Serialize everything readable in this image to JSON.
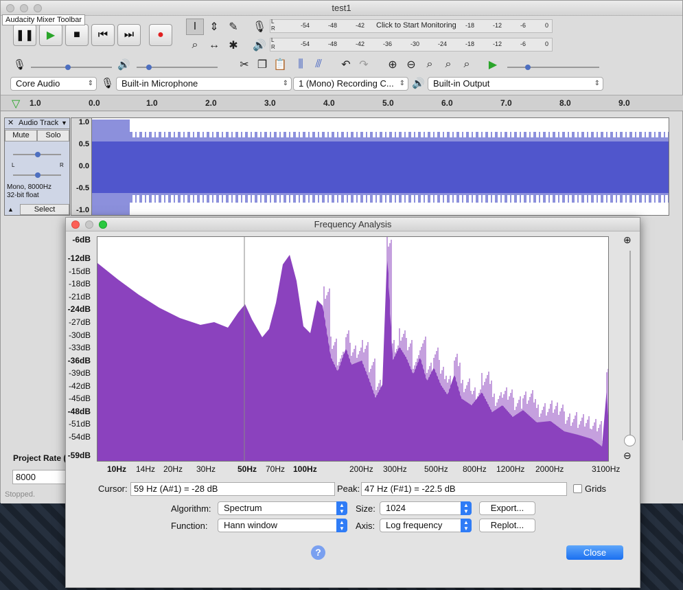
{
  "window": {
    "title": "test1"
  },
  "tooltip": "Audacity Mixer Toolbar",
  "meter": {
    "record_ticks": [
      "L",
      "R",
      "-54",
      "-48",
      "-42",
      "Click to Start Monitoring",
      "-18",
      "-12",
      "-6",
      "0"
    ],
    "play_ticks": [
      "L",
      "R",
      "-54",
      "-48",
      "-42",
      "-36",
      "-30",
      "-24",
      "-18",
      "-12",
      "-6",
      "0"
    ]
  },
  "devices": {
    "host": "Core Audio",
    "recording": "Built-in Microphone",
    "channels": "1 (Mono) Recording C...",
    "playback": "Built-in Output"
  },
  "ruler": {
    "labels": [
      "1.0",
      "0.0",
      "1.0",
      "2.0",
      "3.0",
      "4.0",
      "5.0",
      "6.0",
      "7.0",
      "8.0",
      "9.0"
    ]
  },
  "track": {
    "name": "Audio Track",
    "mute": "Mute",
    "solo": "Solo",
    "left": "L",
    "right": "R",
    "info1": "Mono, 8000Hz",
    "info2": "32-bit float",
    "select": "Select",
    "yticks": [
      "1.0",
      "0.5",
      "0.0",
      "-0.5",
      "-1.0"
    ]
  },
  "selection_bar": {
    "project_rate_label": "Project Rate (H",
    "project_rate": "8000",
    "status": "Stopped."
  },
  "freq": {
    "title": "Frequency Analysis",
    "db_labels": [
      "-6dB",
      "-12dB",
      "-15dB",
      "-18dB",
      "-21dB",
      "-24dB",
      "-27dB",
      "-30dB",
      "-33dB",
      "-36dB",
      "-39dB",
      "-42dB",
      "-45dB",
      "-48dB",
      "-51dB",
      "-54dB",
      "-59dB"
    ],
    "hz_labels": [
      "10Hz",
      "14Hz",
      "20Hz",
      "30Hz",
      "50Hz",
      "70Hz",
      "100Hz",
      "200Hz",
      "300Hz",
      "500Hz",
      "800Hz",
      "1200Hz",
      "2000Hz",
      "3100Hz"
    ],
    "cursor_label": "Cursor:",
    "cursor_value": "59 Hz (A#1) = -28 dB",
    "peak_label": "Peak:",
    "peak_value": "47 Hz (F#1) = -22.5 dB",
    "grids_label": "Grids",
    "algorithm_label": "Algorithm:",
    "algorithm": "Spectrum",
    "function_label": "Function:",
    "function": "Hann window",
    "size_label": "Size:",
    "size": "1024",
    "axis_label": "Axis:",
    "axis": "Log frequency",
    "export": "Export...",
    "replot": "Replot...",
    "close": "Close",
    "help": "?",
    "fill_color": "#8b42be"
  }
}
